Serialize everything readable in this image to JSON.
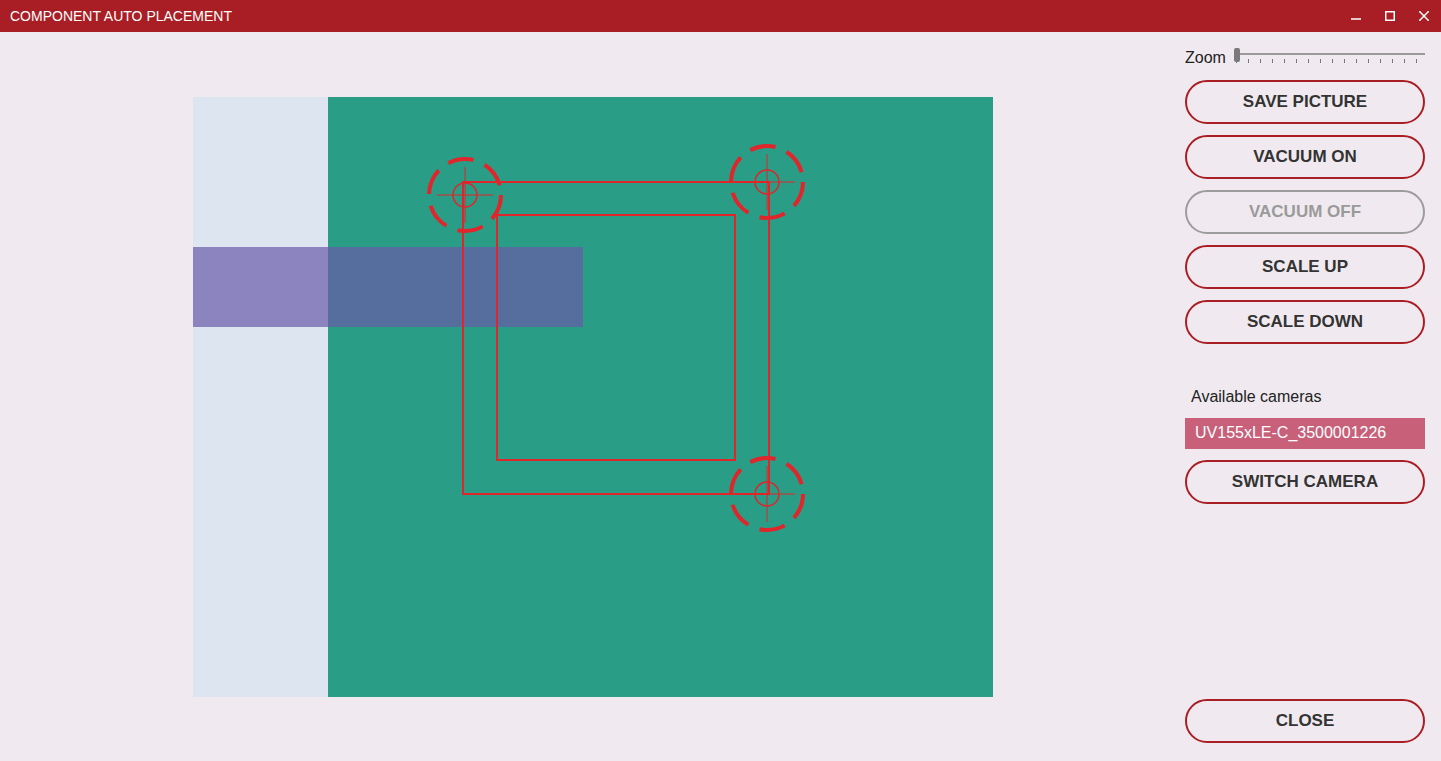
{
  "window": {
    "title": "COMPONENT AUTO PLACEMENT"
  },
  "zoom": {
    "label": "Zoom",
    "level": 0
  },
  "actions": [
    {
      "label": "SAVE PICTURE",
      "disabled": false
    },
    {
      "label": "VACUUM ON",
      "disabled": false
    },
    {
      "label": "VACUUM OFF",
      "disabled": true
    },
    {
      "label": "SCALE UP",
      "disabled": false
    },
    {
      "label": "SCALE DOWN",
      "disabled": false
    }
  ],
  "cameras": {
    "label": "Available cameras",
    "items": [
      {
        "label": "UV155xLE-C_3500001226",
        "selected": true
      }
    ]
  },
  "switch_button": {
    "label": "SWITCH CAMERA",
    "disabled": false
  },
  "close_button": {
    "label": "CLOSE",
    "disabled": false
  }
}
